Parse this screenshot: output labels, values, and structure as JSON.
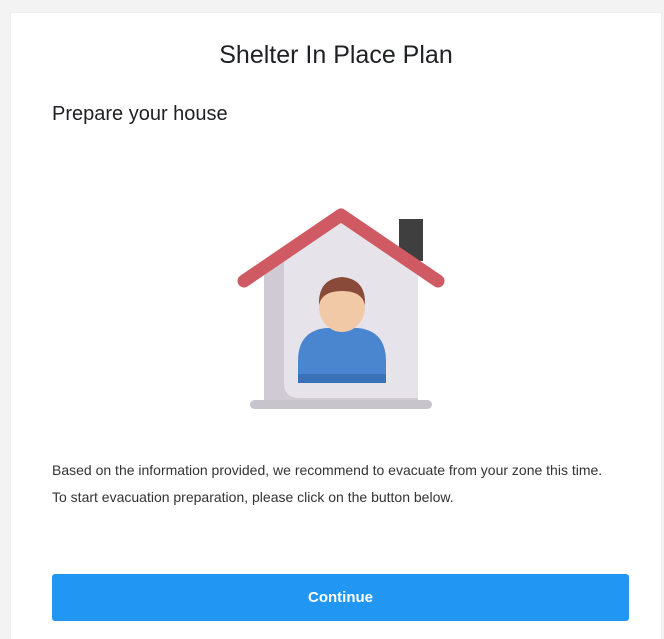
{
  "page": {
    "title": "Shelter In Place Plan",
    "subtitle": "Prepare your house",
    "message": "Based on the information provided, we recommend to evacuate from your zone this time. To start evacuation preparation, please click on the button below.",
    "continue_label": "Continue"
  },
  "colors": {
    "accent": "#2196f3",
    "roof": "#d05a64",
    "chimney": "#444444",
    "house_wall": "#e7e3ea",
    "person_shirt": "#4a86d0",
    "person_hair": "#8a4a3a",
    "person_skin": "#f2c9a6"
  },
  "icons": {
    "illustration": "house-person-icon"
  }
}
